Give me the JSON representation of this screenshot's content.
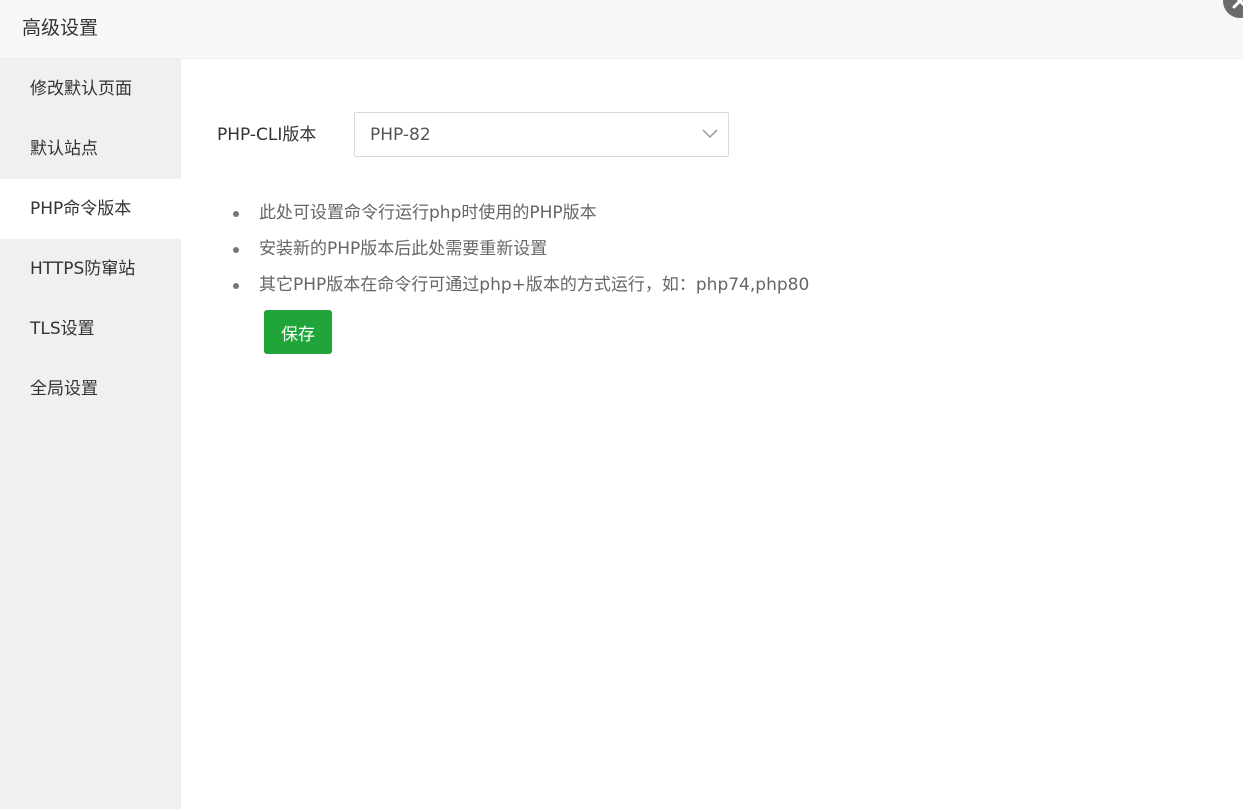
{
  "dialog": {
    "title": "高级设置"
  },
  "sidebar": {
    "items": [
      {
        "label": "修改默认页面",
        "active": false
      },
      {
        "label": "默认站点",
        "active": false
      },
      {
        "label": "PHP命令版本",
        "active": true
      },
      {
        "label": "HTTPS防窜站",
        "active": false
      },
      {
        "label": "TLS设置",
        "active": false
      },
      {
        "label": "全局设置",
        "active": false
      }
    ]
  },
  "form": {
    "label": "PHP-CLI版本",
    "selected_value": "PHP-82"
  },
  "tips": [
    "此处可设置命令行运行php时使用的PHP版本",
    "安装新的PHP版本后此处需要重新设置",
    "其它PHP版本在命令行可通过php+版本的方式运行，如：php74,php80"
  ],
  "actions": {
    "save_label": "保存"
  },
  "colors": {
    "accent": "#20a53a",
    "sidebar_bg": "#f0f0f0",
    "header_bg": "#f8f8f8",
    "close_button": "#6b6b6b"
  },
  "icons": {
    "close": "close-icon",
    "select": "chevron-down-icon"
  }
}
